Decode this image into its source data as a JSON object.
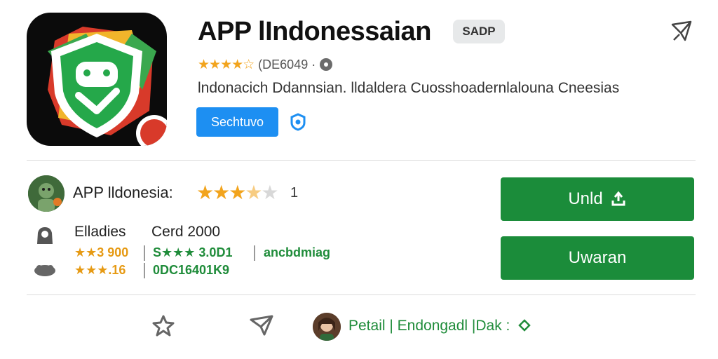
{
  "app": {
    "title": "APP lIndonessaian",
    "tag": "SADP",
    "rating_stars": "★★★★☆",
    "rating_text": "(DE6049 ·",
    "description": "lndonacich Ddannsian. lldaldera Cuosshoadernlalouna Cneesias",
    "install_chip_label": "Sechtuvo"
  },
  "details": {
    "title": "APP lldonesia:",
    "stars_filled": 3,
    "stars_half": 1,
    "stars_empty": 1,
    "stars_suffix": "1",
    "stat1_label": "Elladies",
    "stat1_value": "Cerd 2000",
    "stat2_a": "★★3 900",
    "stat2_b": "S★★★ 3.0D1",
    "stat2_c": "ancbdmiag",
    "stat3_a": "★★★.16",
    "stat3_b": "0DC16401K9"
  },
  "actions": {
    "primary_label": "Unld",
    "secondary_label": "Uwaran"
  },
  "footer": {
    "link_text": "Petail | Endongadl  |Dak :"
  },
  "colors": {
    "green": "#1b8c3a",
    "blue": "#1d8ff2",
    "star": "#f2a41d"
  },
  "icons": [
    "share-icon",
    "verified-icon",
    "download-icon",
    "star-outline-icon",
    "send-icon",
    "diamond-icon"
  ]
}
